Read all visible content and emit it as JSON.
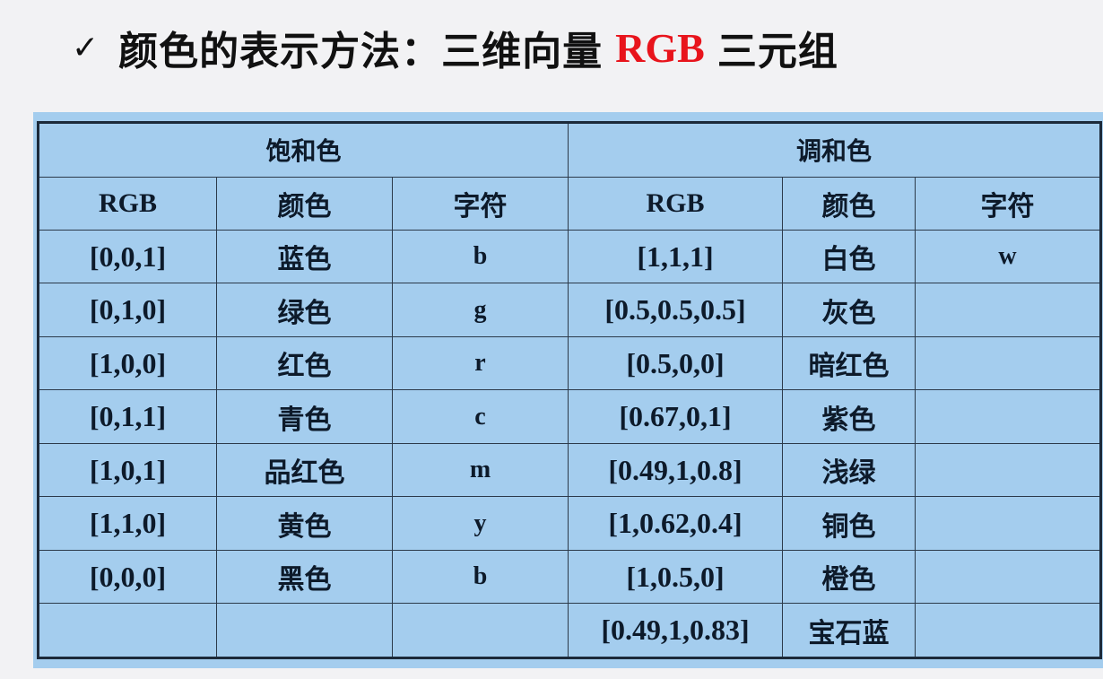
{
  "heading": {
    "check_mark": "✓",
    "text_before": "颜色的表示方法：三维向量",
    "highlight": "RGB",
    "text_after": "三元组",
    "highlight_color": "#e8141c"
  },
  "table": {
    "groups": [
      "饱和色",
      "调和色"
    ],
    "columns": [
      "RGB",
      "颜色",
      "字符",
      "RGB",
      "颜色",
      "字符"
    ],
    "rows": [
      [
        "[0,0,1]",
        "蓝色",
        "b",
        "[1,1,1]",
        "白色",
        "w"
      ],
      [
        "[0,1,0]",
        "绿色",
        "g",
        "[0.5,0.5,0.5]",
        "灰色",
        ""
      ],
      [
        "[1,0,0]",
        "红色",
        "r",
        "[0.5,0,0]",
        "暗红色",
        ""
      ],
      [
        "[0,1,1]",
        "青色",
        "c",
        "[0.67,0,1]",
        "紫色",
        ""
      ],
      [
        "[1,0,1]",
        "品红色",
        "m",
        "[0.49,1,0.8]",
        "浅绿",
        ""
      ],
      [
        "[1,1,0]",
        "黄色",
        "y",
        "[1,0.62,0.4]",
        "铜色",
        ""
      ],
      [
        "[0,0,0]",
        "黑色",
        "b",
        "[1,0.5,0]",
        "橙色",
        ""
      ],
      [
        "",
        "",
        "",
        "[0.49,1,0.83]",
        "宝石蓝",
        ""
      ]
    ],
    "background_color": "#a4cdee",
    "border_color": "#1c2a3a"
  }
}
